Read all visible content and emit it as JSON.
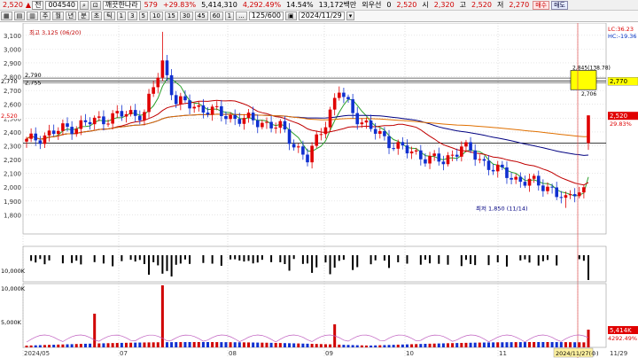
{
  "toolbar": {
    "price": "2,520",
    "code_label": "전",
    "code": "004540",
    "name": "깨끗한나라",
    "change": "579",
    "change_pct": "+29.83%",
    "volume": "5,414,310",
    "turnover_pct": "4,292.49%",
    "ratio": "14.54%",
    "trade_value": "13,172백만",
    "investor": "외우선",
    "zero": "0",
    "ohlc_price": "2,520",
    "open_label": "시",
    "open": "2,320",
    "high_label": "고",
    "high": "2,520",
    "low_label": "저",
    "low": "2,270",
    "sell_label": "매수",
    "buy_label": "매도"
  },
  "period_bar": {
    "periods": [
      "주",
      "월",
      "년",
      "분",
      "초",
      "틱"
    ],
    "intervals": [
      "1",
      "3",
      "5",
      "10",
      "15",
      "30",
      "45",
      "60"
    ],
    "count": "125/600",
    "date": "2024/11/29",
    "misc": [
      "1",
      "..."
    ]
  },
  "right_labels": {
    "lc": "LC:36.23",
    "hc": "HC:-19.36",
    "current_price": "2,520",
    "pct": "29.83%",
    "line_price": "2,770",
    "volume_now": "5,414K",
    "volume_pct": "4292.49%"
  },
  "chart_data": {
    "type": "candlestick",
    "price_axis": {
      "ylim": [
        1700,
        3150
      ],
      "ticks": [
        1800,
        1900,
        2000,
        2100,
        2200,
        2300,
        2400,
        2500,
        2600,
        2700,
        2800,
        2900,
        3000,
        3100
      ],
      "tick_labels": [
        "1,800",
        "1,900",
        "2,000",
        "2,100",
        "2,200",
        "2,300",
        "2,400",
        "2,500",
        "2,600",
        "2,700",
        "2,800",
        "2,900",
        "3,000",
        "3,100"
      ],
      "left_top_labels": [
        "2,520",
        "2,770",
        "2,755",
        "2,790"
      ]
    },
    "x_axis": {
      "labels": [
        "2024/05",
        "07",
        "08",
        "09",
        "10",
        "11",
        "2024/11/27(수)",
        "11/29"
      ]
    },
    "annotations": {
      "high": "최고 3,125 (06/20)",
      "low": "최저 1,850 (11/14)",
      "box_top": "2,845(138.78)",
      "box_bottom": "2,706"
    },
    "volume_axis": {
      "labels": [
        "10,000K",
        "5,000K",
        "10,000K"
      ]
    },
    "current": {
      "open": 2320,
      "high": 2520,
      "low": 2270,
      "close": 2520
    }
  }
}
